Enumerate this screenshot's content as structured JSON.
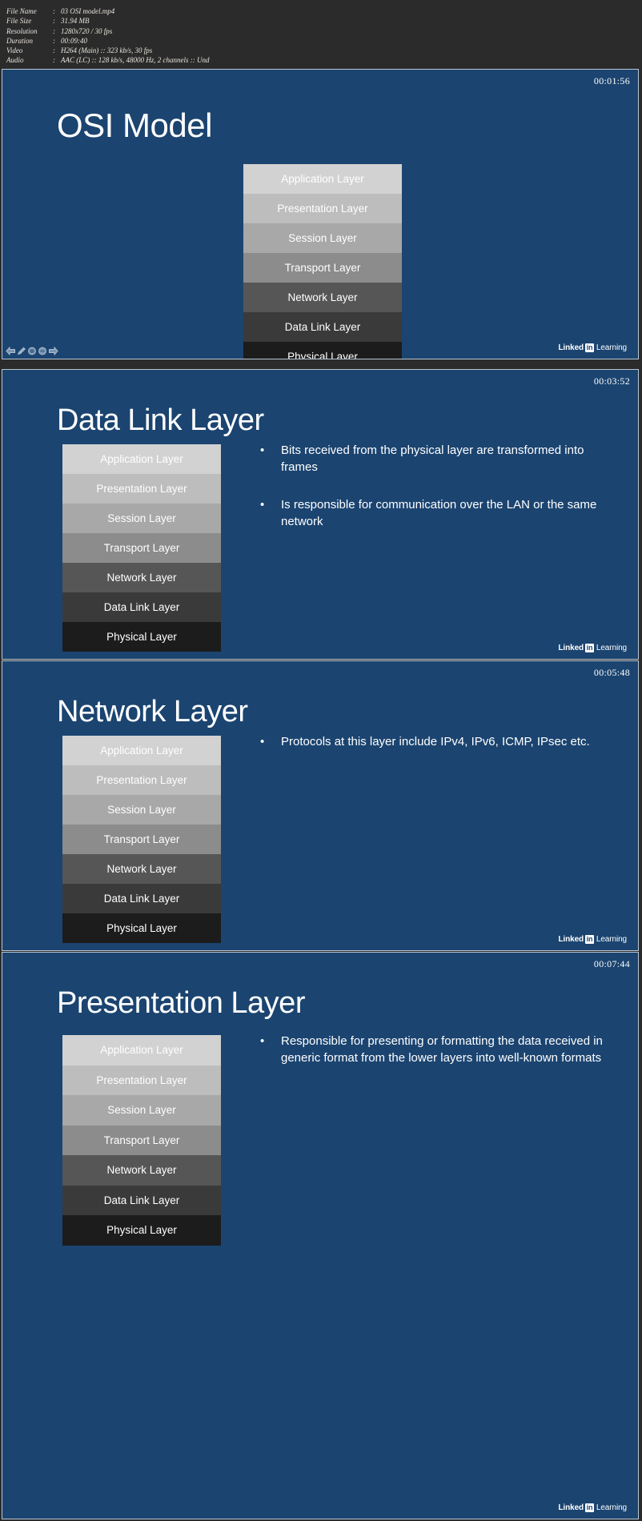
{
  "metadata": {
    "rows": [
      {
        "key": "File Name",
        "colon": ":",
        "value": "03 OSI model.mp4"
      },
      {
        "key": "File Size",
        "colon": ":",
        "value": "31.94 MB"
      },
      {
        "key": "Resolution",
        "colon": ":",
        "value": "1280x720 / 30 fps"
      },
      {
        "key": "Duration",
        "colon": ":",
        "value": "00:09:40"
      },
      {
        "key": "Video",
        "colon": ":",
        "value": "H264 (Main) :: 323 kb/s, 30 fps"
      },
      {
        "key": "Audio",
        "colon": ":",
        "value": "AAC (LC) :: 128 kb/s, 48000 Hz, 2 channels :: Und"
      }
    ]
  },
  "colors": {
    "page_background": "#2b2b2b",
    "slide_background": "#1b4470",
    "slide_border": "#b9c6d4",
    "metadata_text": "#e8e4dc",
    "slide_text": "#ffffff"
  },
  "osi_layers": [
    {
      "label": "Application Layer",
      "color": "#d2d2d2",
      "text_color": "#f0f0f0"
    },
    {
      "label": "Presentation Layer",
      "color": "#bdbdbd",
      "text_color": "#ffffff"
    },
    {
      "label": "Session Layer",
      "color": "#a8a8a8",
      "text_color": "#ffffff"
    },
    {
      "label": "Transport Layer",
      "color": "#8c8c8c",
      "text_color": "#ffffff"
    },
    {
      "label": "Network Layer",
      "color": "#565656",
      "text_color": "#ffffff"
    },
    {
      "label": "Data Link Layer",
      "color": "#3a3a3a",
      "text_color": "#ffffff"
    },
    {
      "label": "Physical Layer",
      "color": "#1c1c1c",
      "text_color": "#ffffff"
    }
  ],
  "branding": {
    "linked": "Linked",
    "in": "in",
    "learning": "Learning"
  },
  "nav_icons": [
    "previous-arrow-icon",
    "pencil-icon",
    "circle-icon",
    "circle-icon",
    "next-arrow-icon"
  ],
  "slides": [
    {
      "timestamp": "00:01:56",
      "title": "OSI Model",
      "bullets": []
    },
    {
      "timestamp": "00:03:52",
      "title": "Data Link Layer",
      "bullets": [
        "Bits received from the physical layer are transformed into frames",
        "Is responsible for communication over the LAN or the same network"
      ]
    },
    {
      "timestamp": "00:05:48",
      "title": "Network Layer",
      "bullets": [
        "Protocols at this layer include IPv4, IPv6, ICMP, IPsec etc."
      ]
    },
    {
      "timestamp": "00:07:44",
      "title": "Presentation Layer",
      "bullets": [
        "Responsible for presenting or formatting the data received in generic format from the lower layers into well-known formats"
      ]
    }
  ]
}
